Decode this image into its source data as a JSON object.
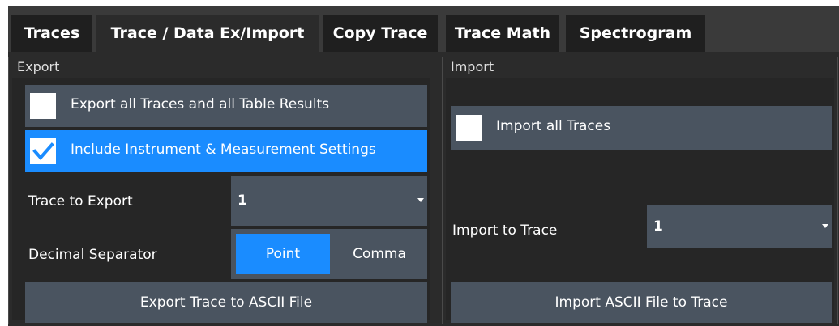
{
  "tabs": [
    {
      "label": "Traces"
    },
    {
      "label": "Trace / Data Ex/Import"
    },
    {
      "label": "Copy Trace"
    },
    {
      "label": "Trace Math"
    },
    {
      "label": "Spectrogram"
    }
  ],
  "active_tab": "Trace / Data Ex/Import",
  "export": {
    "title": "Export",
    "export_all_label": "Export all Traces and all Table Results",
    "export_all_checked": false,
    "include_settings_label": "Include Instrument & Measurement Settings",
    "include_settings_checked": true,
    "trace_to_export_label": "Trace to Export",
    "trace_to_export_value": "1",
    "decimal_separator_label": "Decimal Separator",
    "decimal_options": [
      "Point",
      "Comma"
    ],
    "decimal_selected": "Point",
    "export_button": "Export Trace to ASCII File"
  },
  "import": {
    "title": "Import",
    "import_all_label": "Import all Traces",
    "import_all_checked": false,
    "import_to_trace_label": "Import to Trace",
    "import_to_trace_value": "1",
    "import_button": "Import ASCII File to Trace"
  },
  "colors": {
    "accent": "#1a8cff",
    "control_bg": "#4a5460",
    "panel_bg": "#2b2b2b",
    "tab_bg": "#1f1f1f"
  }
}
